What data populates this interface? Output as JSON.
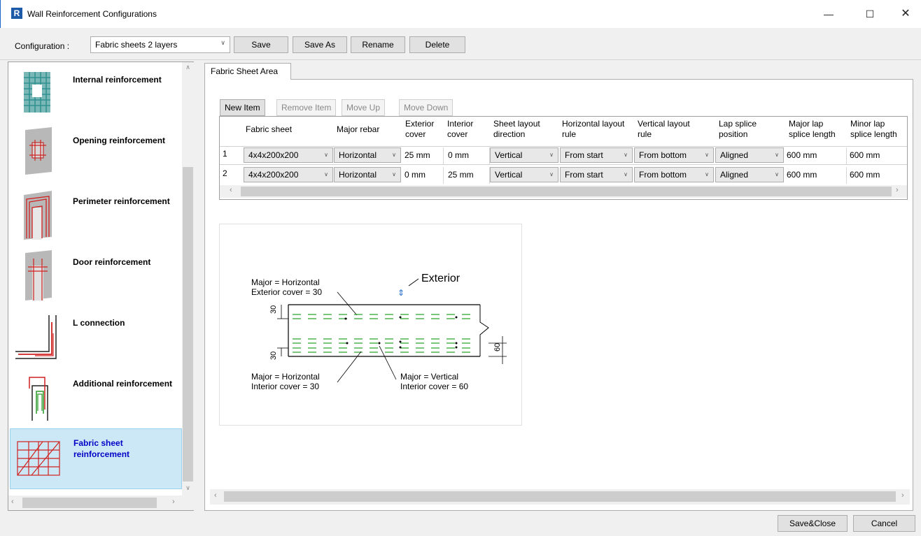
{
  "window": {
    "title": "Wall Reinforcement Configurations",
    "app_icon_letter": "R",
    "minimize": "—",
    "maximize": "☐",
    "close": "✕"
  },
  "config": {
    "label": "Configuration :",
    "selected": "Fabric sheets 2 layers",
    "buttons": {
      "save": "Save",
      "save_as": "Save As",
      "rename": "Rename",
      "delete": "Delete"
    }
  },
  "sidebar": {
    "items": [
      {
        "label": "Internal reinforcement",
        "icon": "internal-reinforcement-icon"
      },
      {
        "label": "Opening reinforcement",
        "icon": "opening-reinforcement-icon"
      },
      {
        "label": "Perimeter reinforcement",
        "icon": "perimeter-reinforcement-icon"
      },
      {
        "label": "Door reinforcement",
        "icon": "door-reinforcement-icon"
      },
      {
        "label": "L connection",
        "icon": "l-connection-icon"
      },
      {
        "label": "Additional reinforcement",
        "icon": "additional-reinforcement-icon"
      },
      {
        "label": "Fabric sheet reinforcement",
        "icon": "fabric-sheet-icon",
        "selected": true
      }
    ]
  },
  "tab": {
    "label": "Fabric Sheet Area"
  },
  "toolbar": {
    "new_item": "New Item",
    "remove_item": "Remove Item",
    "move_up": "Move Up",
    "move_down": "Move Down"
  },
  "grid": {
    "columns": [
      "Fabric sheet",
      "Major rebar",
      "Exterior cover",
      "Interior cover",
      "Sheet layout direction",
      "Horizontal layout rule",
      "Vertical layout rule",
      "Lap splice position",
      "Major lap splice length",
      "Minor lap splice length"
    ],
    "rows": [
      {
        "num": "1",
        "fabric": "4x4x200x200",
        "major": "Horizontal",
        "ext": "25 mm",
        "int": "0 mm",
        "dir": "Vertical",
        "hrule": "From start",
        "vrule": "From bottom",
        "lap": "Aligned",
        "majlap": "600 mm",
        "minlap": "600 mm"
      },
      {
        "num": "2",
        "fabric": "4x4x200x200",
        "major": "Horizontal",
        "ext": "0 mm",
        "int": "25 mm",
        "dir": "Vertical",
        "hrule": "From start",
        "vrule": "From bottom",
        "lap": "Aligned",
        "majlap": "600 mm",
        "minlap": "600 mm"
      }
    ]
  },
  "diagram": {
    "exterior": "Exterior",
    "top_major": "Major = Horizontal",
    "top_cover": "Exterior cover = 30",
    "bot_major": "Major = Horizontal",
    "bot_cover": "Interior cover = 30",
    "vert_major": "Major = Vertical",
    "vert_cover": "Interior cover = 60",
    "dim30_top": "30",
    "dim30_bot": "30",
    "dim60": "60"
  },
  "footer": {
    "save_close": "Save&Close",
    "cancel": "Cancel"
  }
}
